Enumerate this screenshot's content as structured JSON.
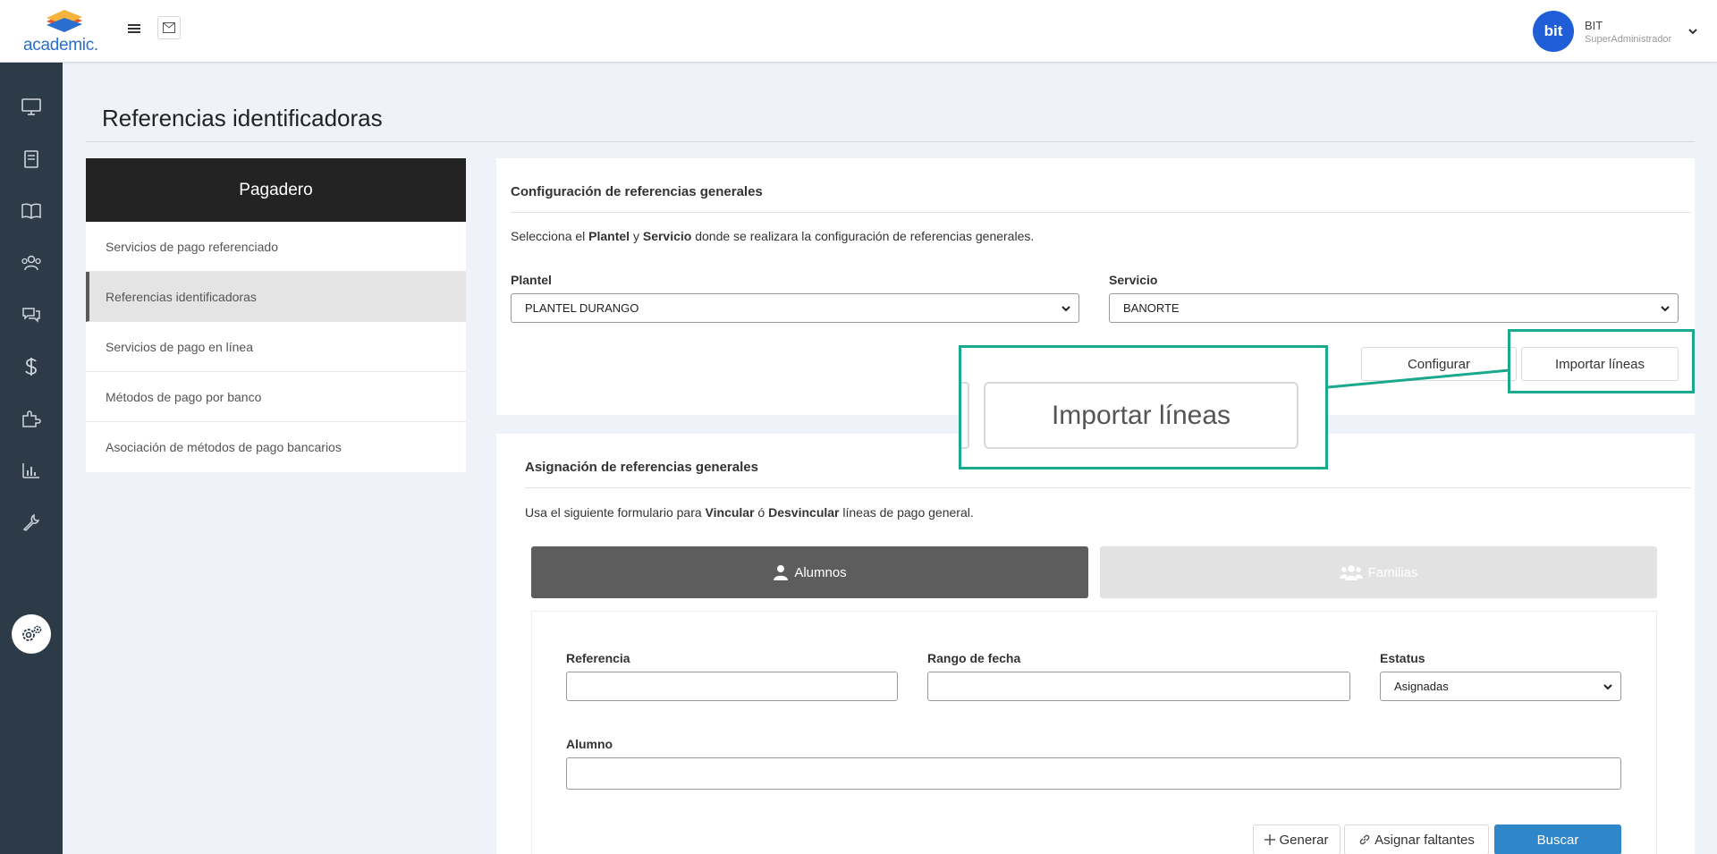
{
  "header": {
    "logo_text": "academic.",
    "user": {
      "avatar_text": "bit",
      "name": "BIT",
      "role": "SuperAdministrador"
    }
  },
  "sidebar": {
    "icons": [
      "monitor-icon",
      "notebook-icon",
      "book-icon",
      "users-icon",
      "chat-icon",
      "dollar-icon",
      "puzzle-icon",
      "chart-icon",
      "wrench-icon",
      "settings-icon"
    ],
    "active": "settings-icon"
  },
  "page": {
    "title": "Referencias identificadoras"
  },
  "left_menu": {
    "header": "Pagadero",
    "items": [
      {
        "label": "Servicios de pago referenciado"
      },
      {
        "label": "Referencias identificadoras",
        "active": true
      },
      {
        "label": "Servicios de pago en línea"
      },
      {
        "label": "Métodos de pago por banco"
      },
      {
        "label": "Asociación de métodos de pago bancarios"
      }
    ]
  },
  "config_card": {
    "title": "Configuración de referencias generales",
    "desc_pre": "Selecciona el ",
    "desc_b1": "Plantel",
    "desc_mid": " y ",
    "desc_b2": "Servicio",
    "desc_post": " donde se realizara la configuración de referencias generales.",
    "plantel_label": "Plantel",
    "plantel_value": "PLANTEL DURANGO",
    "servicio_label": "Servicio",
    "servicio_value": "BANORTE",
    "configurar_label": "Configurar",
    "importar_label": "Importar líneas"
  },
  "zoom": {
    "label": "Importar líneas",
    "highlight_color": "#1aa98c"
  },
  "assign_card": {
    "title": "Asignación de referencias generales",
    "desc_pre": "Usa el siguiente formulario para ",
    "desc_b1": "Vincular",
    "desc_mid": " ó ",
    "desc_b2": "Desvincular",
    "desc_post": " líneas de pago general.",
    "tabs": [
      {
        "label": "Alumnos",
        "icon": "user-icon",
        "active": true
      },
      {
        "label": "Familias",
        "icon": "users-icon",
        "active": false
      }
    ],
    "referencia_label": "Referencia",
    "referencia_value": "",
    "rango_label": "Rango de fecha",
    "rango_value": "",
    "estatus_label": "Estatus",
    "estatus_value": "Asignadas",
    "alumno_label": "Alumno",
    "alumno_value": "",
    "generar_label": "Generar",
    "asignar_label": "Asignar faltantes",
    "buscar_label": "Buscar"
  },
  "colors": {
    "sidebar": "#2d3b48",
    "primary": "#2f86c8",
    "highlight": "#1aa98c",
    "menu_header": "#232323"
  }
}
